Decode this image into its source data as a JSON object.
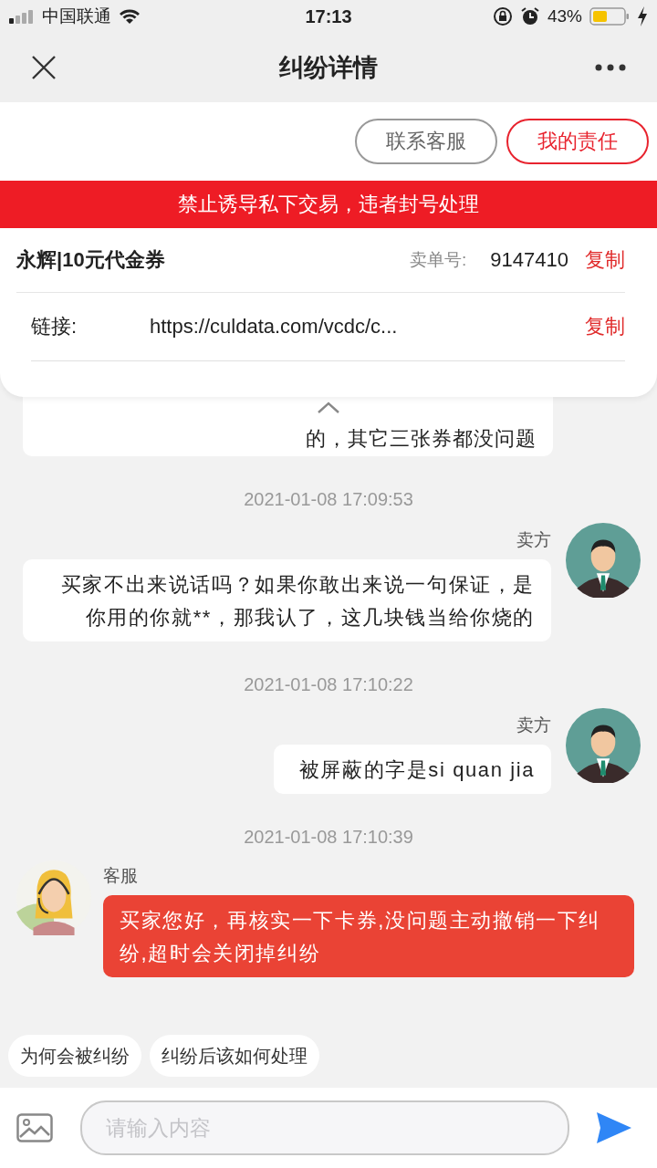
{
  "status_bar": {
    "carrier": "中国联通",
    "time": "17:13",
    "battery": "43%"
  },
  "nav": {
    "title": "纠纷详情"
  },
  "actions": [
    {
      "label": "联系客服",
      "kind": "outline"
    },
    {
      "label": "我的责任",
      "kind": "primary"
    }
  ],
  "banner": "禁止诱导私下交易，违者封号处理",
  "order": {
    "name": "永辉|10元代金券",
    "number_label": "卖单号:",
    "number": "9147410",
    "copy": "复制",
    "link_label": "链接:",
    "link": "https://culdata.com/vcdc/c...",
    "link_copy": "复制"
  },
  "chat": [
    {
      "kind": "partial",
      "text": "的，其它三张券都没问题"
    },
    {
      "kind": "time",
      "text": "2021-01-08 17:09:53"
    },
    {
      "kind": "seller",
      "sender": "卖方",
      "text": "买家不出来说话吗？如果你敢出来说一句保证，是你用的你就**，那我认了，这几块钱当给你烧的"
    },
    {
      "kind": "time",
      "text": "2021-01-08 17:10:22"
    },
    {
      "kind": "seller",
      "sender": "卖方",
      "text": "被屏蔽的字是si quan jia"
    },
    {
      "kind": "time",
      "text": "2021-01-08 17:10:39"
    },
    {
      "kind": "service",
      "sender": "客服",
      "text": "买家您好，再核实一下卡券,没问题主动撤销一下纠纷,超时会关闭掉纠纷"
    }
  ],
  "quick_replies": [
    "为何会被纠纷",
    "纠纷后该如何处理"
  ],
  "input": {
    "placeholder": "请输入内容"
  }
}
